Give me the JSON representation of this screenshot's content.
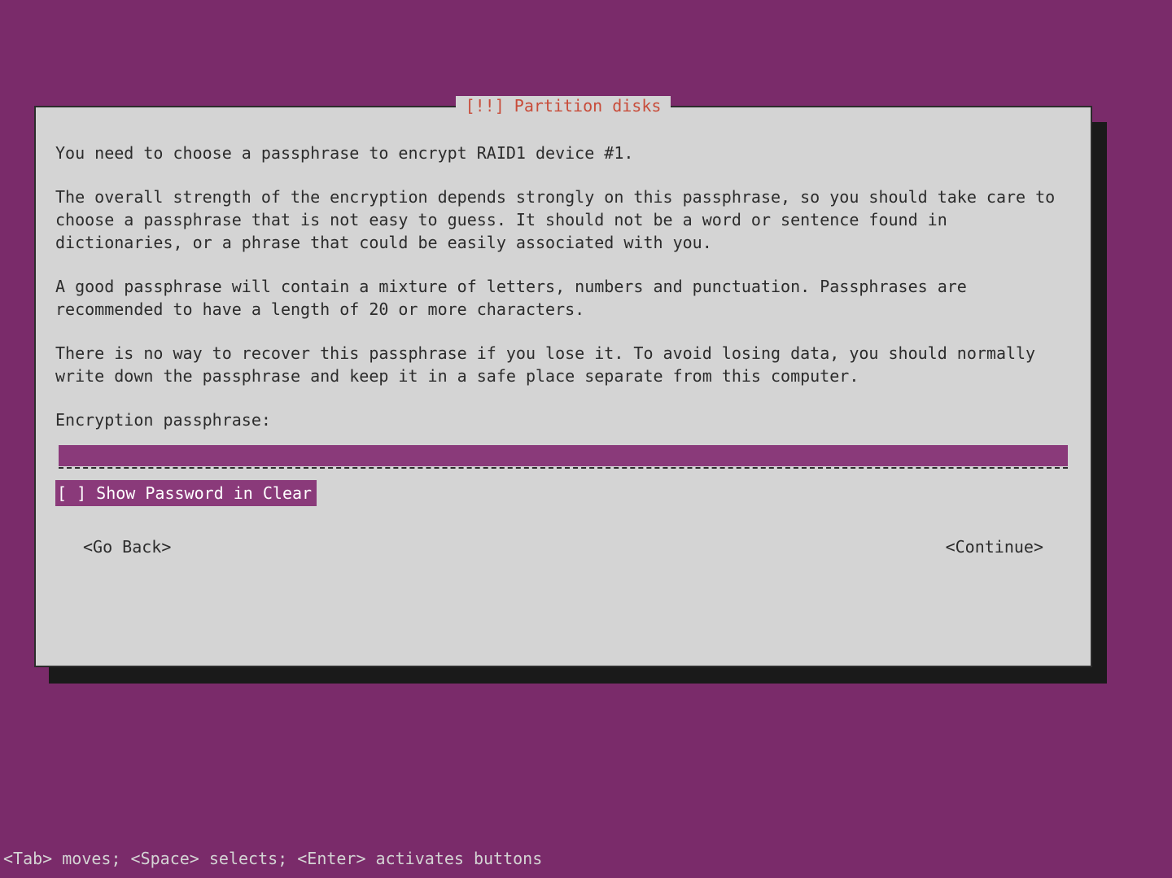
{
  "dialog": {
    "title_marker": "[!!]",
    "title": "Partition disks",
    "paragraphs": {
      "p1": "You need to choose a passphrase to encrypt RAID1 device #1.",
      "p2": "The overall strength of the encryption depends strongly on this passphrase, so you should take care to choose a passphrase that is not easy to guess. It should not be a word or sentence found in dictionaries, or a phrase that could be easily associated with you.",
      "p3": "A good passphrase will contain a mixture of letters, numbers and punctuation. Passphrases are recommended to have a length of 20 or more characters.",
      "p4": "There is no way to recover this passphrase if you lose it. To avoid losing data, you should normally write down the passphrase and keep it in a safe place separate from this computer."
    },
    "prompt_label": "Encryption passphrase:",
    "input_value": "",
    "checkbox": {
      "state": "[ ]",
      "label": "Show Password in Clear"
    },
    "buttons": {
      "back": "<Go Back>",
      "continue": "<Continue>"
    }
  },
  "footer": {
    "hint": "<Tab> moves; <Space> selects; <Enter> activates buttons"
  }
}
